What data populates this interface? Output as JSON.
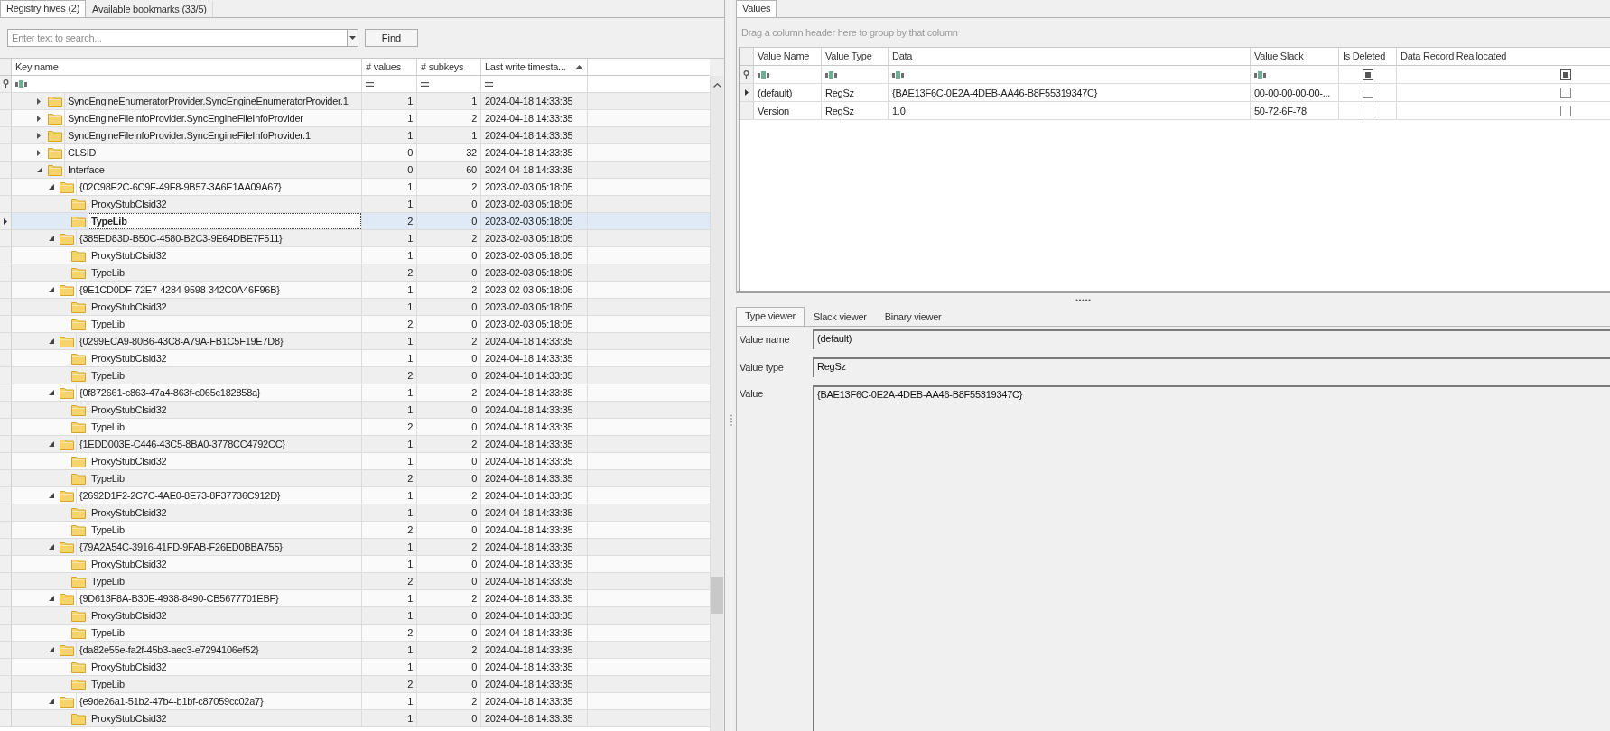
{
  "left_tabs": [
    {
      "label": "Registry hives (2)",
      "selected": true
    },
    {
      "label": "Available bookmarks (33/5)",
      "selected": false
    }
  ],
  "search": {
    "placeholder": "Enter text to search...",
    "button": "Find"
  },
  "tree": {
    "columns": [
      {
        "label": "Key name",
        "kind": "text",
        "sorted": false
      },
      {
        "label": "# values",
        "kind": "number",
        "sorted": false
      },
      {
        "label": "# subkeys",
        "kind": "number",
        "sorted": false
      },
      {
        "label": "Last write timesta...",
        "kind": "number",
        "sorted": true
      }
    ],
    "rows": [
      {
        "name": "SyncEngineEnumeratorProvider.SyncEngineEnumeratorProvider.1",
        "values": "1",
        "subkeys": "1",
        "timestamp": "2024-04-18 14:33:35",
        "expanded": false,
        "selected": false
      },
      {
        "name": "SyncEngineFileInfoProvider.SyncEngineFileInfoProvider",
        "values": "1",
        "subkeys": "2",
        "timestamp": "2024-04-18 14:33:35",
        "expanded": false,
        "selected": false
      },
      {
        "name": "SyncEngineFileInfoProvider.SyncEngineFileInfoProvider.1",
        "values": "1",
        "subkeys": "1",
        "timestamp": "2024-04-18 14:33:35",
        "expanded": false,
        "selected": false
      },
      {
        "name": "CLSID",
        "values": "0",
        "subkeys": "32",
        "timestamp": "2024-04-18 14:33:35",
        "expanded": false,
        "selected": false
      },
      {
        "name": "Interface",
        "values": "0",
        "subkeys": "60",
        "timestamp": "2024-04-18 14:33:35",
        "expanded": true,
        "selected": false,
        "children": [
          {
            "name": "{02C98E2C-6C9F-49F8-9B57-3A6E1AA09A67}",
            "values": "1",
            "subkeys": "2",
            "timestamp": "2023-02-03 05:18:05",
            "expanded": true,
            "selected": false,
            "children": [
              {
                "name": "ProxyStubClsid32",
                "values": "1",
                "subkeys": "0",
                "timestamp": "2023-02-03 05:18:05",
                "selected": false
              },
              {
                "name": "TypeLib",
                "values": "2",
                "subkeys": "0",
                "timestamp": "2023-02-03 05:18:05",
                "selected": true
              }
            ]
          },
          {
            "name": "{385ED83D-B50C-4580-B2C3-9E64DBE7F511}",
            "values": "1",
            "subkeys": "2",
            "timestamp": "2023-02-03 05:18:05",
            "expanded": true,
            "selected": false,
            "children": [
              {
                "name": "ProxyStubClsid32",
                "values": "1",
                "subkeys": "0",
                "timestamp": "2023-02-03 05:18:05",
                "selected": false
              },
              {
                "name": "TypeLib",
                "values": "2",
                "subkeys": "0",
                "timestamp": "2023-02-03 05:18:05",
                "selected": false
              }
            ]
          },
          {
            "name": "{9E1CD0DF-72E7-4284-9598-342C0A46F96B}",
            "values": "1",
            "subkeys": "2",
            "timestamp": "2023-02-03 05:18:05",
            "expanded": true,
            "selected": false,
            "children": [
              {
                "name": "ProxyStubClsid32",
                "values": "1",
                "subkeys": "0",
                "timestamp": "2023-02-03 05:18:05",
                "selected": false
              },
              {
                "name": "TypeLib",
                "values": "2",
                "subkeys": "0",
                "timestamp": "2023-02-03 05:18:05",
                "selected": false
              }
            ]
          },
          {
            "name": "{0299ECA9-80B6-43C8-A79A-FB1C5F19E7D8}",
            "values": "1",
            "subkeys": "2",
            "timestamp": "2024-04-18 14:33:35",
            "expanded": true,
            "selected": false,
            "children": [
              {
                "name": "ProxyStubClsid32",
                "values": "1",
                "subkeys": "0",
                "timestamp": "2024-04-18 14:33:35",
                "selected": false
              },
              {
                "name": "TypeLib",
                "values": "2",
                "subkeys": "0",
                "timestamp": "2024-04-18 14:33:35",
                "selected": false
              }
            ]
          },
          {
            "name": "{0f872661-c863-47a4-863f-c065c182858a}",
            "values": "1",
            "subkeys": "2",
            "timestamp": "2024-04-18 14:33:35",
            "expanded": true,
            "selected": false,
            "children": [
              {
                "name": "ProxyStubClsid32",
                "values": "1",
                "subkeys": "0",
                "timestamp": "2024-04-18 14:33:35",
                "selected": false
              },
              {
                "name": "TypeLib",
                "values": "2",
                "subkeys": "0",
                "timestamp": "2024-04-18 14:33:35",
                "selected": false
              }
            ]
          },
          {
            "name": "{1EDD003E-C446-43C5-8BA0-3778CC4792CC}",
            "values": "1",
            "subkeys": "2",
            "timestamp": "2024-04-18 14:33:35",
            "expanded": true,
            "selected": false,
            "children": [
              {
                "name": "ProxyStubClsid32",
                "values": "1",
                "subkeys": "0",
                "timestamp": "2024-04-18 14:33:35",
                "selected": false
              },
              {
                "name": "TypeLib",
                "values": "2",
                "subkeys": "0",
                "timestamp": "2024-04-18 14:33:35",
                "selected": false
              }
            ]
          },
          {
            "name": "{2692D1F2-2C7C-4AE0-8E73-8F37736C912D}",
            "values": "1",
            "subkeys": "2",
            "timestamp": "2024-04-18 14:33:35",
            "expanded": true,
            "selected": false,
            "children": [
              {
                "name": "ProxyStubClsid32",
                "values": "1",
                "subkeys": "0",
                "timestamp": "2024-04-18 14:33:35",
                "selected": false
              },
              {
                "name": "TypeLib",
                "values": "2",
                "subkeys": "0",
                "timestamp": "2024-04-18 14:33:35",
                "selected": false
              }
            ]
          },
          {
            "name": "{79A2A54C-3916-41FD-9FAB-F26ED0BBA755}",
            "values": "1",
            "subkeys": "2",
            "timestamp": "2024-04-18 14:33:35",
            "expanded": true,
            "selected": false,
            "children": [
              {
                "name": "ProxyStubClsid32",
                "values": "1",
                "subkeys": "0",
                "timestamp": "2024-04-18 14:33:35",
                "selected": false
              },
              {
                "name": "TypeLib",
                "values": "2",
                "subkeys": "0",
                "timestamp": "2024-04-18 14:33:35",
                "selected": false
              }
            ]
          },
          {
            "name": "{9D613F8A-B30E-4938-8490-CB5677701EBF}",
            "values": "1",
            "subkeys": "2",
            "timestamp": "2024-04-18 14:33:35",
            "expanded": true,
            "selected": false,
            "children": [
              {
                "name": "ProxyStubClsid32",
                "values": "1",
                "subkeys": "0",
                "timestamp": "2024-04-18 14:33:35",
                "selected": false
              },
              {
                "name": "TypeLib",
                "values": "2",
                "subkeys": "0",
                "timestamp": "2024-04-18 14:33:35",
                "selected": false
              }
            ]
          },
          {
            "name": "{da82e55e-fa2f-45b3-aec3-e7294106ef52}",
            "values": "1",
            "subkeys": "2",
            "timestamp": "2024-04-18 14:33:35",
            "expanded": true,
            "selected": false,
            "children": [
              {
                "name": "ProxyStubClsid32",
                "values": "1",
                "subkeys": "0",
                "timestamp": "2024-04-18 14:33:35",
                "selected": false
              },
              {
                "name": "TypeLib",
                "values": "2",
                "subkeys": "0",
                "timestamp": "2024-04-18 14:33:35",
                "selected": false
              }
            ]
          },
          {
            "name": "{e9de26a1-51b2-47b4-b1bf-c87059cc02a7}",
            "values": "1",
            "subkeys": "2",
            "timestamp": "2024-04-18 14:33:35",
            "expanded": true,
            "selected": false,
            "children": [
              {
                "name": "ProxyStubClsid32",
                "values": "1",
                "subkeys": "0",
                "timestamp": "2024-04-18 14:33:35",
                "selected": false
              }
            ]
          }
        ]
      }
    ]
  },
  "values_tab": {
    "label": "Values",
    "selected": true
  },
  "values": {
    "group_hint": "Drag a column header here to group by that column",
    "columns": [
      {
        "label": "Value Name",
        "kind": "text"
      },
      {
        "label": "Value Type",
        "kind": "text"
      },
      {
        "label": "Data",
        "kind": "text"
      },
      {
        "label": "Value Slack",
        "kind": "text"
      },
      {
        "label": "Is Deleted",
        "kind": "checkbox",
        "indeterminate": true
      },
      {
        "label": "Data Record Reallocated",
        "kind": "checkbox",
        "indeterminate": true
      }
    ],
    "rows": [
      {
        "value_name": "(default)",
        "value_type": "RegSz",
        "data": "{BAE13F6C-0E2A-4DEB-AA46-B8F55319347C}",
        "value_slack": "00-00-00-00-00-...",
        "is_deleted": false,
        "reallocated": false,
        "selected": true
      },
      {
        "value_name": "Version",
        "value_type": "RegSz",
        "data": "1.0",
        "value_slack": "50-72-6F-78",
        "is_deleted": false,
        "reallocated": false,
        "selected": false
      }
    ]
  },
  "viewer": {
    "tabs": [
      {
        "label": "Type viewer",
        "selected": true
      },
      {
        "label": "Slack viewer",
        "selected": false
      },
      {
        "label": "Binary viewer",
        "selected": false
      }
    ],
    "fields": [
      {
        "label": "Value name",
        "value": "(default)",
        "kind": "line"
      },
      {
        "label": "Value type",
        "value": "RegSz",
        "kind": "line"
      },
      {
        "label": "Value",
        "value": "{BAE13F6C-0E2A-4DEB-AA46-B8F55319347C}",
        "kind": "area"
      }
    ]
  }
}
